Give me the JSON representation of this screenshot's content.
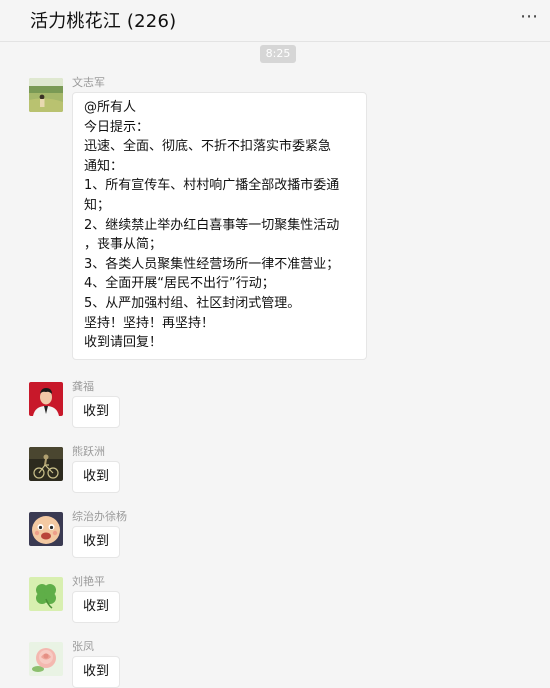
{
  "header": {
    "title": "活力桃花江 (226)",
    "more_icon": "more-dots-icon",
    "more_glyph": "⋯"
  },
  "timestamp": "8:25",
  "messages": [
    {
      "sender": "文志军",
      "avatar": "field-photo-avatar",
      "lines": [
        "@所有人",
        "今日提示：",
        "迅速、全面、彻底、不折不扣落实市委紧急",
        "通知：",
        "1、所有宣传车、村村响广播全部改播市委通",
        "知；",
        "2、继续禁止举办红白喜事等一切聚集性活动",
        "，丧事从简；",
        "3、各类人员聚集性经营场所一律不准营业；",
        "4、全面开展“居民不出行”行动；",
        "5、从严加强村组、社区封闭式管理。",
        "坚持！坚持！再坚持！",
        "收到请回复！"
      ]
    },
    {
      "sender": "龚福",
      "avatar": "man-red-background-avatar",
      "text": "收到"
    },
    {
      "sender": "熊跃洲",
      "avatar": "cyclist-night-avatar",
      "text": "收到"
    },
    {
      "sender": "综治办徐杨",
      "avatar": "baby-face-avatar",
      "text": "收到"
    },
    {
      "sender": "刘艳平",
      "avatar": "clover-avatar",
      "text": "收到"
    },
    {
      "sender": "张凤",
      "avatar": "pink-rose-avatar",
      "text": "收到"
    }
  ]
}
